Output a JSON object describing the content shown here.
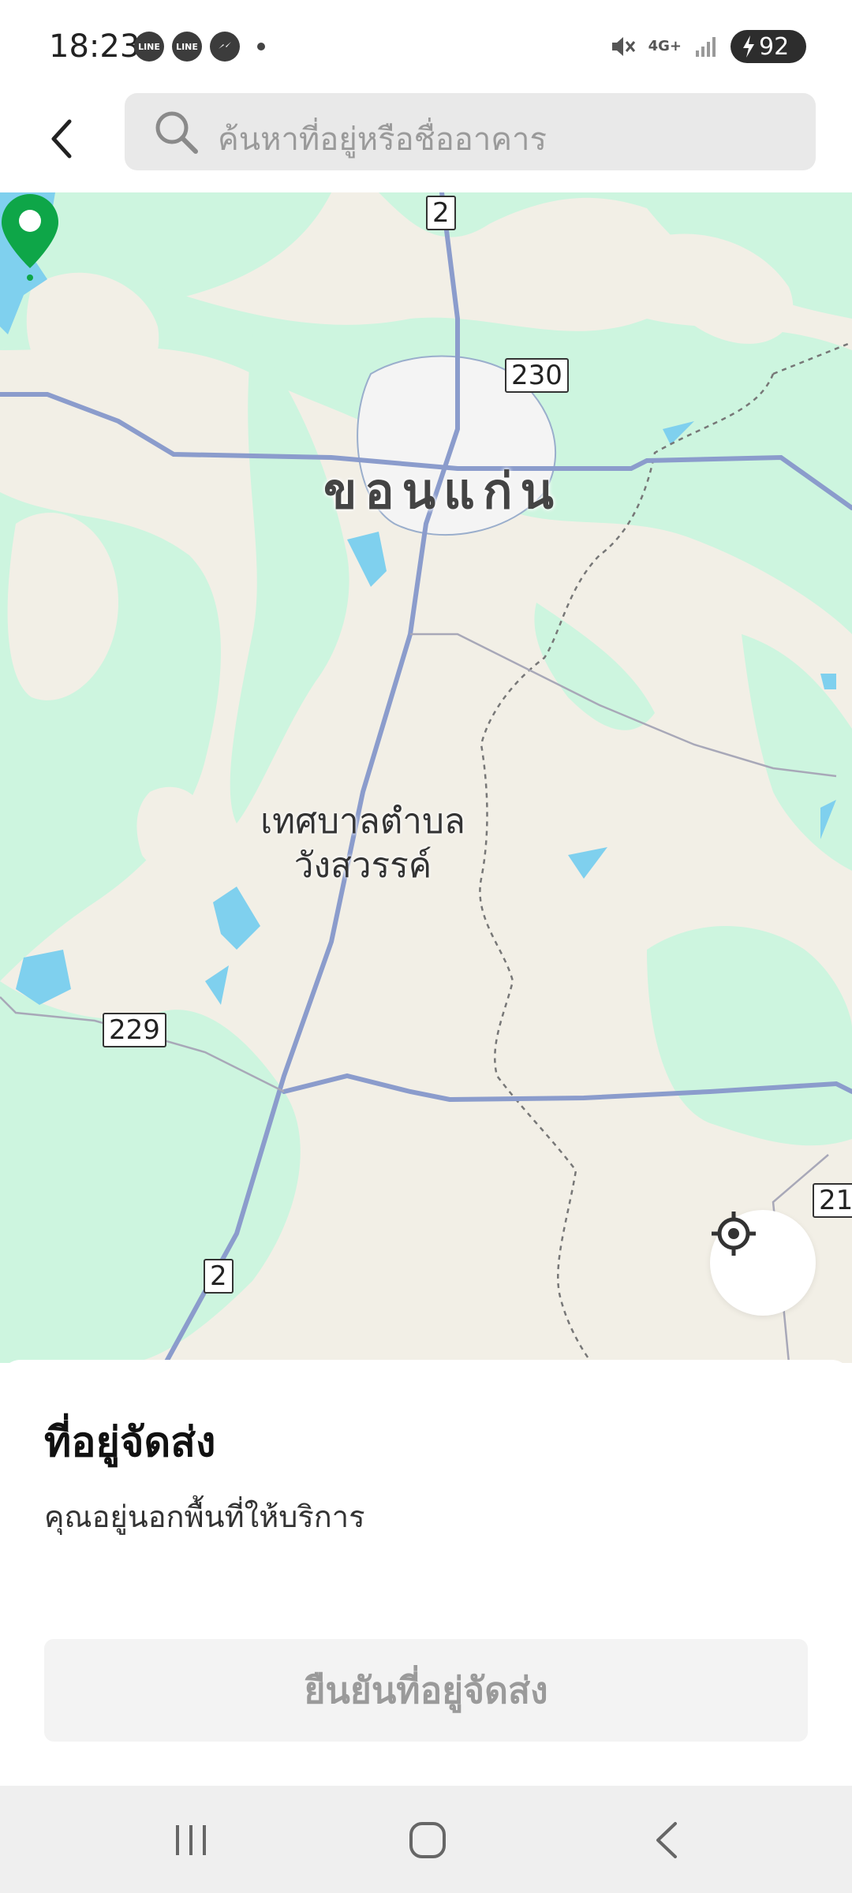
{
  "status_bar": {
    "time": "18:23",
    "app_icons": [
      "LINE",
      "LINE",
      "messenger"
    ],
    "network": "4G+",
    "battery": "92"
  },
  "search": {
    "placeholder": "ค้นหาที่อยู่หรือชื่ออาคาร"
  },
  "map": {
    "city_label": "ขอนแก่น",
    "town_label_line1": "เทศบาลตำบล",
    "town_label_line2": "วังสวรรค์",
    "road_shields": [
      "2",
      "230",
      "229",
      "2",
      "21"
    ],
    "pin_color": "#0ea648",
    "colors": {
      "land": "#f2efe6",
      "forest": "#cdf5df",
      "water": "#7fd0ee",
      "road": "#8b9ccc"
    }
  },
  "sheet": {
    "title": "ที่อยู่จัดส่ง",
    "subtitle": "คุณอยู่นอกพื้นที่ให้บริการ",
    "confirm_label": "ยืนยันที่อยู่จัดส่ง"
  },
  "icons": {
    "back": "chevron-left-icon",
    "search": "search-icon",
    "locate": "crosshair-icon",
    "nav_recents": "recents-icon",
    "nav_home": "home-icon",
    "nav_back": "back-icon"
  }
}
